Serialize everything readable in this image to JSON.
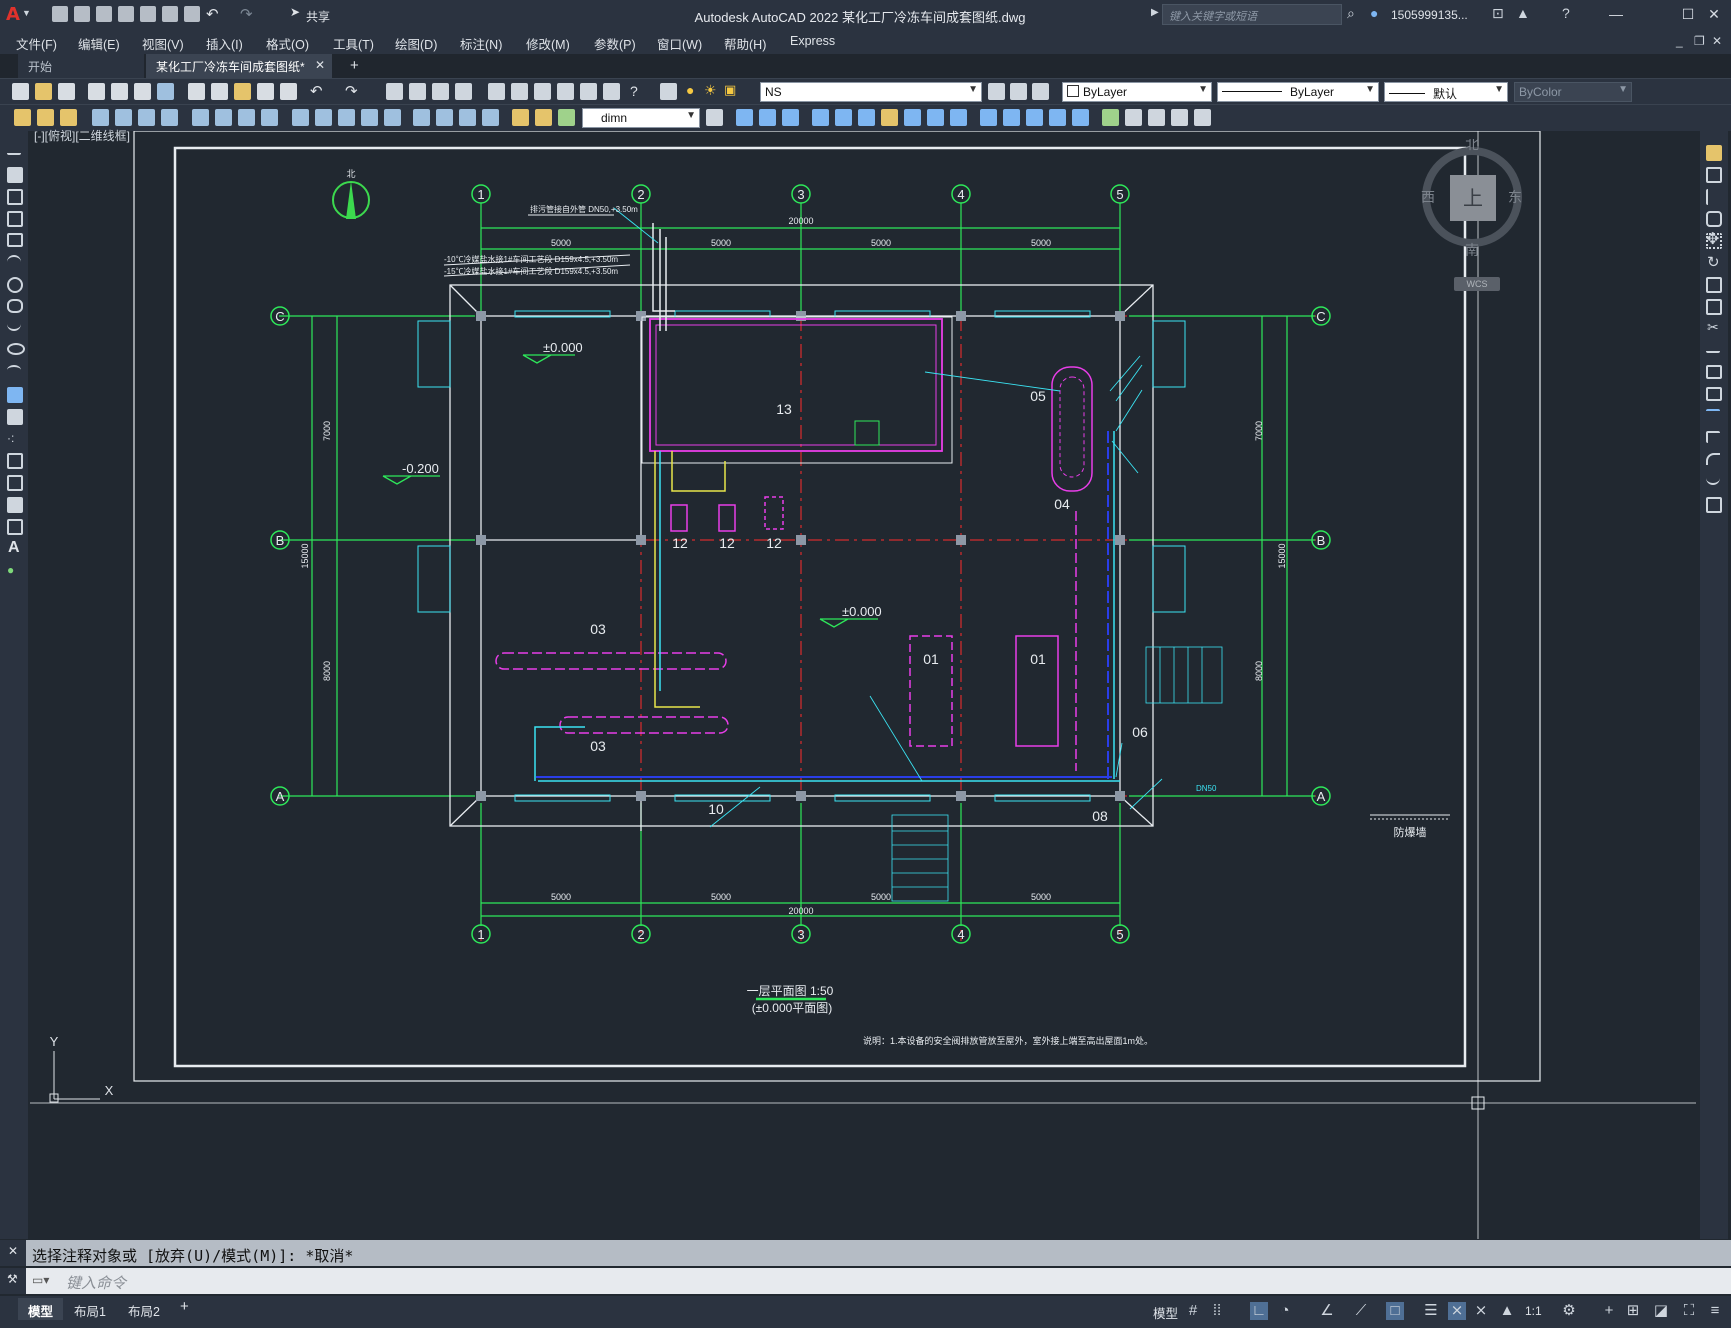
{
  "app": {
    "logo_letter": "A",
    "title": "Autodesk AutoCAD 2022    某化工厂冷冻车间成套图纸.dwg",
    "search_placeholder": "键入关键字或短语",
    "user": "1505999135...",
    "share_label": "共享"
  },
  "menu": [
    "文件(F)",
    "编辑(E)",
    "视图(V)",
    "插入(I)",
    "格式(O)",
    "工具(T)",
    "绘图(D)",
    "标注(N)",
    "修改(M)",
    "参数(P)",
    "窗口(W)",
    "帮助(H)",
    "Express"
  ],
  "tabs": [
    {
      "label": "开始"
    },
    {
      "label": "某化工厂冷冻车间成套图纸*"
    }
  ],
  "toolbar": {
    "layer_combo": "NS",
    "color_combo": "ByLayer",
    "linetype_combo": "ByLayer",
    "lineweight_combo": "默认",
    "plotstyle_combo": "ByColor",
    "dimstyle_combo": "dimn"
  },
  "viewport_label": "[-][俯视][二维线框]",
  "viewcube": {
    "north": "北",
    "south": "南",
    "east": "东",
    "west": "西",
    "top": "上",
    "wcs": "WCS"
  },
  "drawing": {
    "grid_cols": [
      "1",
      "2",
      "3",
      "4",
      "5"
    ],
    "grid_rows": [
      "C",
      "B",
      "A"
    ],
    "dim_total": "20000",
    "dim_span": "5000",
    "dim_left_top": "7000",
    "dim_left_bottom": "8000",
    "dim_left_total": "15000",
    "levels": [
      "±0.000",
      "-0.200",
      "±0.000"
    ],
    "rooms": [
      "13",
      "12",
      "12",
      "12",
      "03",
      "03",
      "01",
      "01",
      "05",
      "04",
      "06",
      "08",
      "10"
    ],
    "notes": [
      "排污管接自外管 DN50,+3.50m",
      "-10℃冷媒盐水接1#车间工艺段 D159x4.5,+3.50m",
      "-15℃冷媒盐水接1#车间工艺段 D159x4.5,+3.50m",
      "防爆墙",
      "DN50"
    ],
    "title_main": "一层平面图 1:50",
    "title_sub": "(±0.000平面图)",
    "footnote": "说明：1.本设备的安全阀排放管放至屋外，室外接上端至高出屋面1m处。",
    "north_label": "北"
  },
  "command": {
    "history": "选择注释对象或 [放弃(U)/模式(M)]: *取消*",
    "prompt_placeholder": "键入命令"
  },
  "layout_tabs": [
    "模型",
    "布局1",
    "布局2"
  ],
  "status": {
    "model": "模型",
    "scale": "1:1"
  }
}
